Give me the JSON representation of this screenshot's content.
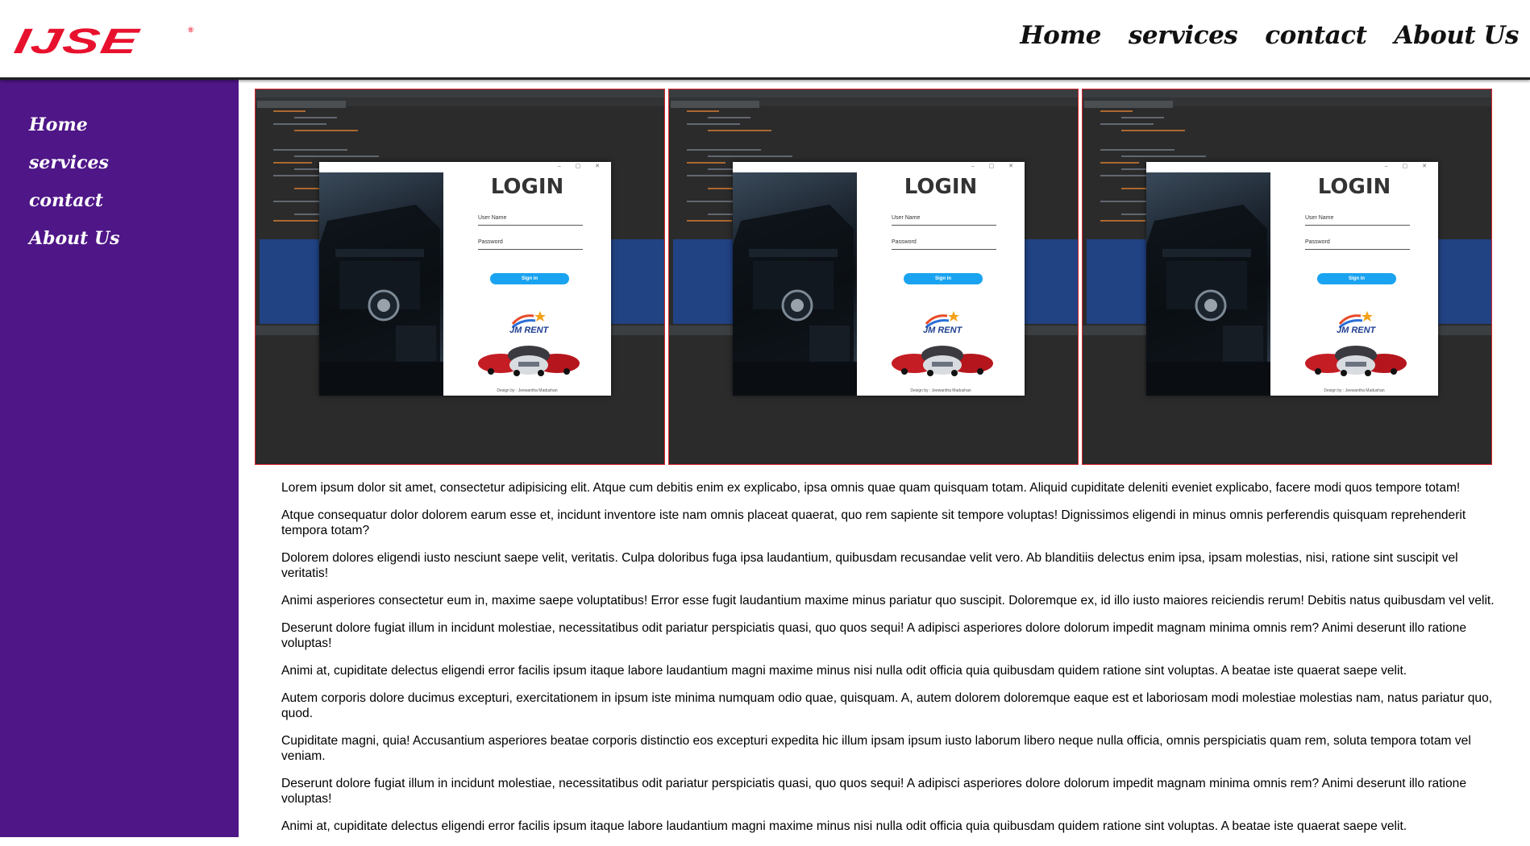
{
  "brand": {
    "logo_text": "IJSE",
    "registered_mark": "®",
    "logo_color": "#e8112d"
  },
  "topnav": [
    {
      "label": "Home"
    },
    {
      "label": "services"
    },
    {
      "label": "contact"
    },
    {
      "label": "About Us"
    }
  ],
  "sidebar": {
    "background": "#4e1687",
    "items": [
      {
        "label": "Home"
      },
      {
        "label": "services"
      },
      {
        "label": "contact"
      },
      {
        "label": "About Us"
      }
    ]
  },
  "gallery": {
    "border_color": "#d9262e",
    "shots": [
      {
        "login_title": "LOGIN",
        "username_label": "User Name",
        "password_label": "Password",
        "signin_label": "Sign in",
        "app_name": "JM RENT",
        "designer": "Design by : Jeewantha Madushan"
      },
      {
        "login_title": "LOGIN",
        "username_label": "User Name",
        "password_label": "Password",
        "signin_label": "Sign in",
        "app_name": "JM RENT",
        "designer": "Design by : Jeewantha Madushan"
      },
      {
        "login_title": "LOGIN",
        "username_label": "User Name",
        "password_label": "Password",
        "signin_label": "Sign in",
        "app_name": "JM RENT",
        "designer": "Design by : Jeewantha Madushan"
      }
    ]
  },
  "content": {
    "paragraphs": [
      "Lorem ipsum dolor sit amet, consectetur adipisicing elit. Atque cum debitis enim ex explicabo, ipsa omnis quae quam quisquam totam. Aliquid cupiditate deleniti eveniet explicabo, facere modi quos tempore totam!",
      "Atque consequatur dolor dolorem earum esse et, incidunt inventore iste nam omnis placeat quaerat, quo rem sapiente sit tempore voluptas! Dignissimos eligendi in minus omnis perferendis quisquam reprehenderit tempora totam?",
      "Dolorem dolores eligendi iusto nesciunt saepe velit, veritatis. Culpa doloribus fuga ipsa laudantium, quibusdam recusandae velit vero. Ab blanditiis delectus enim ipsa, ipsam molestias, nisi, ratione sint suscipit vel veritatis!",
      "Animi asperiores consectetur eum in, maxime saepe voluptatibus! Error esse fugit laudantium maxime minus pariatur quo suscipit. Doloremque ex, id illo iusto maiores reiciendis rerum! Debitis natus quibusdam vel velit.",
      "Deserunt dolore fugiat illum in incidunt molestiae, necessitatibus odit pariatur perspiciatis quasi, quo quos sequi! A adipisci asperiores dolore dolorum impedit magnam minima omnis rem? Animi deserunt illo ratione voluptas!",
      "Animi at, cupiditate delectus eligendi error facilis ipsum itaque labore laudantium magni maxime minus nisi nulla odit officia quia quibusdam quidem ratione sint voluptas. A beatae iste quaerat saepe velit.",
      "Autem corporis dolore ducimus excepturi, exercitationem in ipsum iste minima numquam odio quae, quisquam. A, autem dolorem doloremque eaque est et laboriosam modi molestiae molestias nam, natus pariatur quo, quod.",
      "Cupiditate magni, quia! Accusantium asperiores beatae corporis distinctio eos excepturi expedita hic illum ipsam ipsum iusto laborum libero neque nulla officia, omnis perspiciatis quam rem, soluta tempora totam vel veniam.",
      "Deserunt dolore fugiat illum in incidunt molestiae, necessitatibus odit pariatur perspiciatis quasi, quo quos sequi! A adipisci asperiores dolore dolorum impedit magnam minima omnis rem? Animi deserunt illo ratione voluptas!",
      "Animi at, cupiditate delectus eligendi error facilis ipsum itaque labore laudantium magni maxime minus nisi nulla odit officia quia quibusdam quidem ratione sint voluptas. A beatae iste quaerat saepe velit."
    ]
  }
}
